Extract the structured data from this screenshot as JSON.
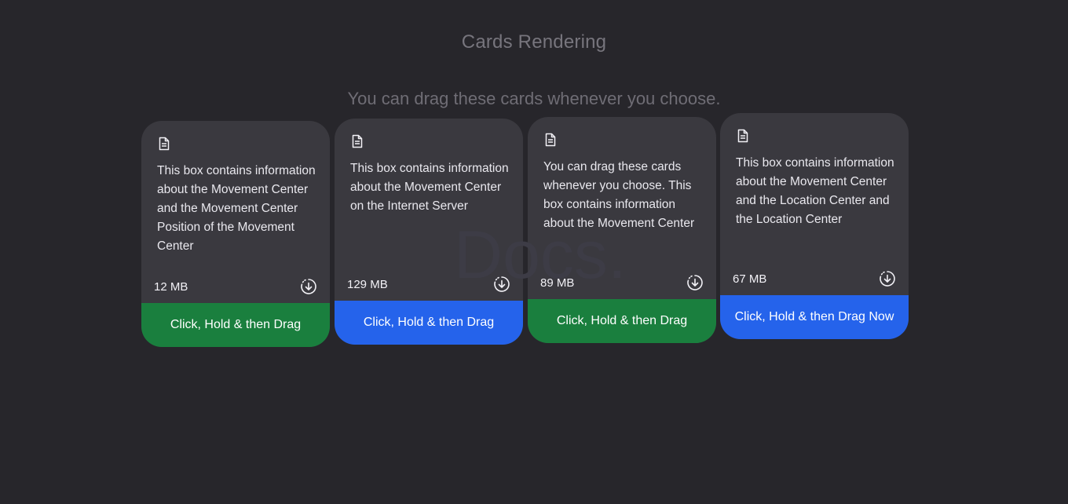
{
  "page": {
    "title": "Cards Rendering",
    "subtitle": "You can drag these cards whenever you choose.",
    "watermark": "Docs."
  },
  "colors": {
    "background": "#27262b",
    "card": "#3a393f",
    "green": "#1a7f3e",
    "blue": "#2563eb"
  },
  "icons": {
    "document": "document-icon",
    "download": "download-circle-icon"
  },
  "cards": [
    {
      "description": "This box contains information about the Movement Center and the Movement Center Position of the Movement Center",
      "size": "12 MB",
      "button_label": "Click, Hold & then Drag",
      "button_color": "#1a7f3e"
    },
    {
      "description": "This box contains information about the Movement Center on the Internet Server",
      "size": "129 MB",
      "button_label": "Click, Hold & then Drag",
      "button_color": "#2563eb"
    },
    {
      "description": "You can drag these cards whenever you choose. This box contains information about the Movement Center",
      "size": "89 MB",
      "button_label": "Click, Hold & then Drag",
      "button_color": "#1a7f3e"
    },
    {
      "description": "This box contains information about the Movement Center and the Location Center and the Location Center",
      "size": "67 MB",
      "button_label": "Click, Hold & then Drag Now",
      "button_color": "#2563eb"
    }
  ]
}
